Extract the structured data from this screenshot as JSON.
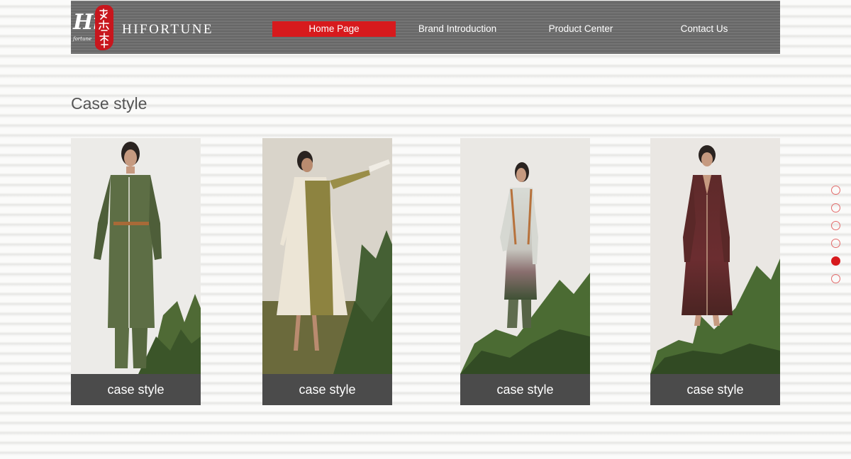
{
  "brand": {
    "logo_mark": "Hi",
    "logo_mark_sub": "fortune",
    "name": "HIFORTUNE",
    "accent_color": "#d71a1d",
    "seal_color": "#c8161d"
  },
  "nav": {
    "items": [
      {
        "label": "Home Page",
        "active": true
      },
      {
        "label": "Brand Introduction",
        "active": false
      },
      {
        "label": "Product Center",
        "active": false
      },
      {
        "label": "Contact Us",
        "active": false
      }
    ]
  },
  "page": {
    "title": "Case style"
  },
  "cases": [
    {
      "caption": "case style",
      "image": "model-olive-green-trench-coat-photo"
    },
    {
      "caption": "case style",
      "image": "model-cream-sheer-dress-photo"
    },
    {
      "caption": "case style",
      "image": "model-grey-gradient-long-coat-photo"
    },
    {
      "caption": "case style",
      "image": "model-burgundy-long-dress-photo"
    }
  ],
  "pagination": {
    "total": 6,
    "active_index": 4
  }
}
